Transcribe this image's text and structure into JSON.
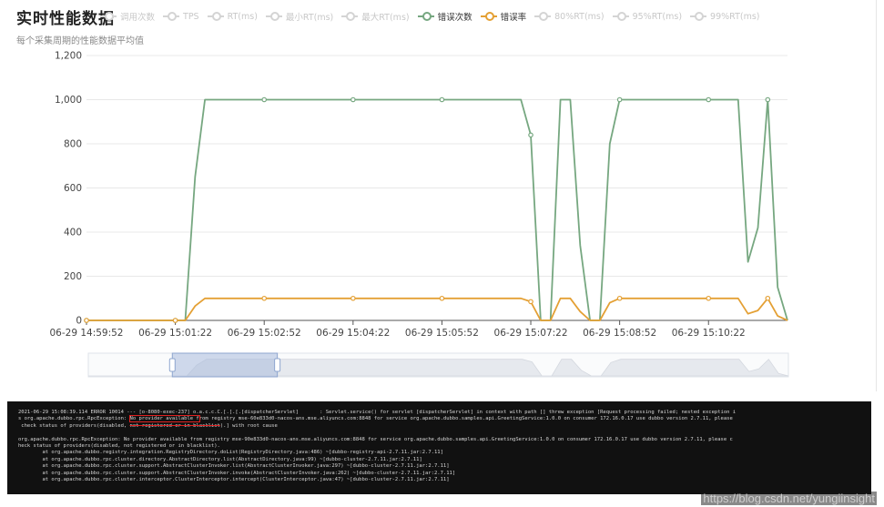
{
  "header": {
    "title": "实时性能数据",
    "subtitle": "每个采集周期的性能数据平均值"
  },
  "legend": [
    {
      "label": "调用次数",
      "active": false,
      "color": "#d4d4d4"
    },
    {
      "label": "TPS",
      "active": false,
      "color": "#d4d4d4"
    },
    {
      "label": "RT(ms)",
      "active": false,
      "color": "#d4d4d4"
    },
    {
      "label": "最小RT(ms)",
      "active": false,
      "color": "#d4d4d4"
    },
    {
      "label": "最大RT(ms)",
      "active": false,
      "color": "#d4d4d4"
    },
    {
      "label": "错误次数",
      "active": true,
      "color": "#76a780"
    },
    {
      "label": "错误率",
      "active": true,
      "color": "#e4a034"
    },
    {
      "label": "80%RT(ms)",
      "active": false,
      "color": "#d4d4d4"
    },
    {
      "label": "95%RT(ms)",
      "active": false,
      "color": "#d4d4d4"
    },
    {
      "label": "99%RT(ms)",
      "active": false,
      "color": "#d4d4d4"
    }
  ],
  "chart_data": {
    "type": "line",
    "x_tick_labels": [
      "06-29 14:59:52",
      "06-29 15:01:22",
      "06-29 15:02:52",
      "06-29 15:04:22",
      "06-29 15:05:52",
      "06-29 15:07:22",
      "06-29 15:08:52",
      "06-29 15:10:22"
    ],
    "x_tick_positions": [
      0,
      9,
      18,
      27,
      36,
      45,
      54,
      63
    ],
    "x_range": [
      0,
      71
    ],
    "ylim": [
      0,
      1200
    ],
    "y_ticks": [
      0,
      200,
      400,
      600,
      800,
      1000,
      1200
    ],
    "y_tick_labels": [
      "0",
      "200",
      "400",
      "600",
      "800",
      "1,000",
      "1,200"
    ],
    "grid": "horizontal",
    "series": [
      {
        "name": "错误次数",
        "color": "#76a780",
        "points": [
          [
            0,
            0
          ],
          [
            9,
            0
          ],
          [
            10,
            0
          ],
          [
            11,
            650
          ],
          [
            12,
            1000
          ],
          [
            18,
            1000
          ],
          [
            27,
            1000
          ],
          [
            36,
            1000
          ],
          [
            44,
            1000
          ],
          [
            45,
            840
          ],
          [
            46,
            0
          ],
          [
            47,
            0
          ],
          [
            48,
            1000
          ],
          [
            49,
            1000
          ],
          [
            50,
            340
          ],
          [
            51,
            0
          ],
          [
            52,
            0
          ],
          [
            53,
            800
          ],
          [
            54,
            1000
          ],
          [
            63,
            1000
          ],
          [
            66,
            1000
          ],
          [
            67,
            265
          ],
          [
            68,
            420
          ],
          [
            69,
            1000
          ],
          [
            70,
            150
          ],
          [
            71,
            0
          ]
        ],
        "markers": [
          [
            0,
            0
          ],
          [
            9,
            0
          ],
          [
            18,
            1000
          ],
          [
            27,
            1000
          ],
          [
            36,
            1000
          ],
          [
            45,
            840
          ],
          [
            54,
            1000
          ],
          [
            63,
            1000
          ],
          [
            69,
            1000
          ]
        ]
      },
      {
        "name": "错误率",
        "color": "#e4a034",
        "points": [
          [
            0,
            0
          ],
          [
            9,
            0
          ],
          [
            10,
            0
          ],
          [
            11,
            65
          ],
          [
            12,
            100
          ],
          [
            18,
            100
          ],
          [
            27,
            100
          ],
          [
            36,
            100
          ],
          [
            44,
            100
          ],
          [
            45,
            85
          ],
          [
            46,
            0
          ],
          [
            47,
            0
          ],
          [
            48,
            100
          ],
          [
            49,
            100
          ],
          [
            50,
            40
          ],
          [
            51,
            0
          ],
          [
            52,
            0
          ],
          [
            53,
            80
          ],
          [
            54,
            100
          ],
          [
            63,
            100
          ],
          [
            66,
            100
          ],
          [
            67,
            30
          ],
          [
            68,
            45
          ],
          [
            69,
            100
          ],
          [
            70,
            20
          ],
          [
            71,
            0
          ]
        ],
        "markers": [
          [
            0,
            0
          ],
          [
            9,
            0
          ],
          [
            18,
            100
          ],
          [
            27,
            100
          ],
          [
            36,
            100
          ],
          [
            45,
            85
          ],
          [
            54,
            100
          ],
          [
            63,
            100
          ],
          [
            69,
            100
          ]
        ]
      }
    ]
  },
  "zoom": {
    "window_start": 0.12,
    "window_end": 0.27
  },
  "console": {
    "lines": [
      "2021-06-29 15:08:39.114 ERROR 10014 --- [o-8080-exec-237] o.a.c.c.C.[.[.[.[dispatcherServlet]       : Servlet.service() for servlet [dispatcherServlet] in context with path [] threw exception [Request processing failed; nested exception i",
      "s org.apache.dubbo.rpc.RpcException: ||HL:No provider available f||rom registry mse-60e833d0-nacos-ans.mse.aliyuncs.com:8848 for service org.apache.dubbo.samples.api.GreetingService:1.0.0 on consumer 172.16.0.17 use dubbo version 2.7.11, please",
      " check status of providers(disabled, ||ST:not registered or in blacklist||).] with root cause",
      "",
      "org.apache.dubbo.rpc.RpcException: No provider available from registry mse-90e833d0-nacos-ans.mse.aliyuncs.com:8848 for service org.apache.dubbo.samples.api.GreetingService:1.0.0 on consumer 172.16.0.17 use dubbo version 2.7.11, please c",
      "heck status of providers(disabled, not registered or in blacklist).",
      "        at org.apache.dubbo.registry.integration.RegistryDirectory.doList(RegistryDirectory.java:486) ~[dubbo-registry-api-2.7.11.jar:2.7.11]",
      "        at org.apache.dubbo.rpc.cluster.directory.AbstractDirectory.list(AbstractDirectory.java:99) ~[dubbo-cluster-2.7.11.jar:2.7.11]",
      "        at org.apache.dubbo.rpc.cluster.support.AbstractClusterInvoker.list(AbstractClusterInvoker.java:297) ~[dubbo-cluster-2.7.11.jar:2.7.11]",
      "        at org.apache.dubbo.rpc.cluster.support.AbstractClusterInvoker.invoke(AbstractClusterInvoker.java:262) ~[dubbo-cluster-2.7.11.jar:2.7.11]",
      "        at org.apache.dubbo.rpc.cluster.interceptor.ClusterInterceptor.intercept(ClusterInterceptor.java:47) ~[dubbo-cluster-2.7.11.jar:2.7.11]"
    ]
  },
  "watermark": "https://blog.csdn.net/yungiinsight"
}
